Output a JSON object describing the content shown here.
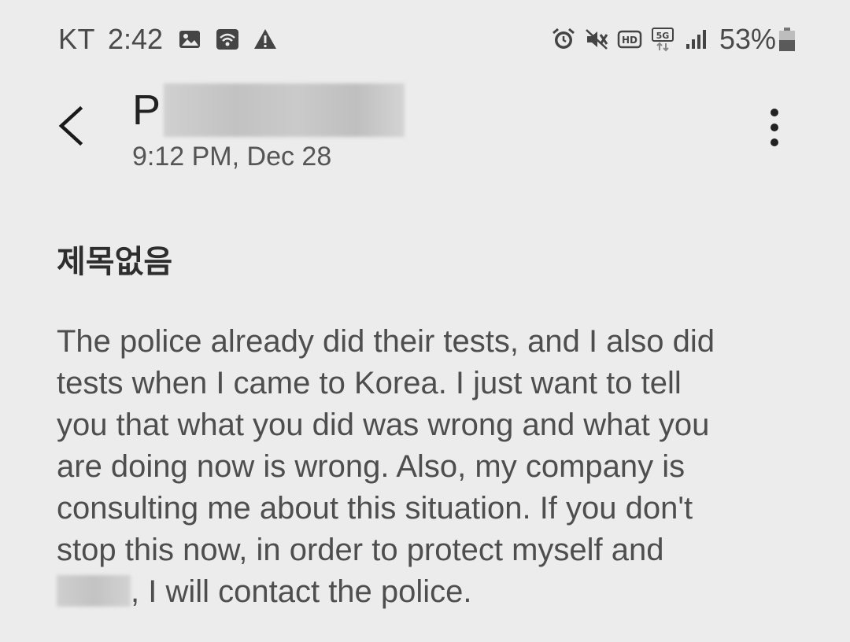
{
  "status_bar": {
    "carrier": "KT",
    "time": "2:42",
    "left_icons": [
      "image-icon",
      "wifi-icon",
      "warning-icon"
    ],
    "right_icons": [
      "alarm-icon",
      "mute-icon",
      "hd-voice-icon",
      "5g-icon",
      "signal-icon"
    ],
    "battery_percent": "53%",
    "battery_level": 0.53
  },
  "header": {
    "back_icon": "chevron-left-icon",
    "sender_initial": "P",
    "sender_name_redacted": true,
    "date": "9:12 PM, Dec 28",
    "more_icon": "more-vertical-icon"
  },
  "message": {
    "subject": "제목없음",
    "body_lines": [
      "The police already did their tests, and I also did",
      "tests when I came to Korea. I just want to tell",
      "you that what you did was wrong and what you",
      "are doing now is wrong. Also, my company is",
      "consulting me about this situation. If you don't",
      "stop this now, in order to protect myself and",
      ", I will contact the police."
    ]
  },
  "colors": {
    "background": "#ececec",
    "text_primary": "#333333",
    "text_body": "#4e4e4e"
  }
}
